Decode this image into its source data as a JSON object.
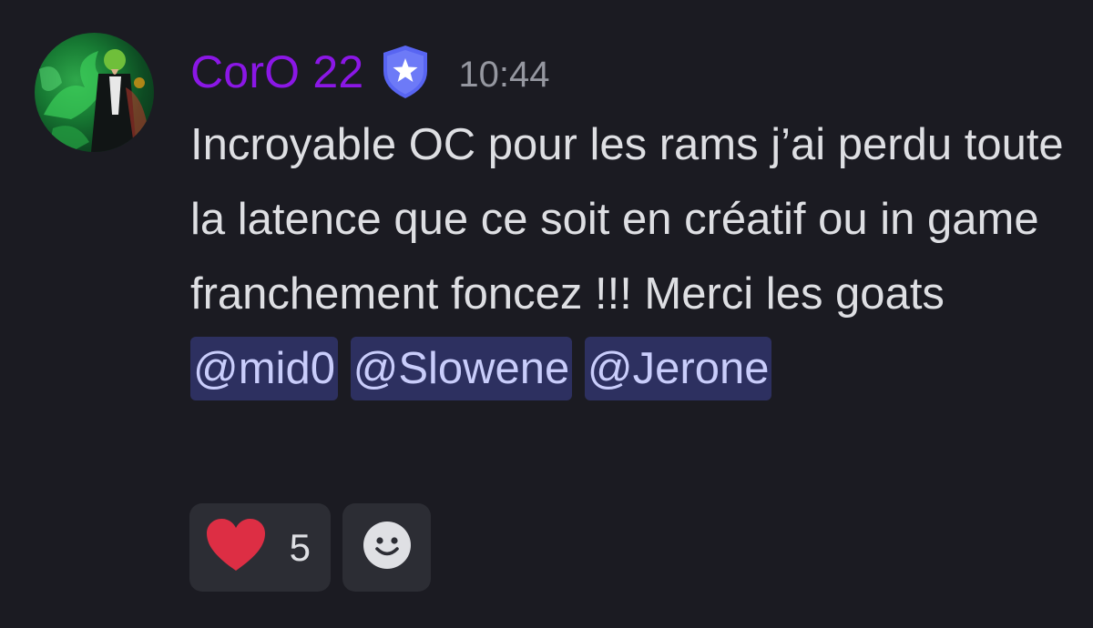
{
  "message": {
    "author": {
      "name": "CorO 22",
      "name_color": "#8b17e6",
      "badge_icon": "shield-star-icon",
      "avatar_icon": "green-dragon-avatar"
    },
    "timestamp": "10:44",
    "text_parts": [
      "Incroyable OC pour les rams j’ai perdu toute la latence que ce soit en créatif ou in game franchement foncez !!! Merci les goats",
      " ",
      " ",
      ""
    ],
    "mentions": [
      "@mid0",
      "@Slowene",
      "@Jerone"
    ],
    "mention_color": "#5865f2"
  },
  "reactions": [
    {
      "emoji": "heart-icon",
      "count": "5",
      "color": "#dd2e44"
    },
    {
      "emoji": "add-reaction-smiley-icon"
    }
  ],
  "colors": {
    "background": "#1b1b22",
    "text": "#dedfe3",
    "timestamp": "#9597a0",
    "reaction_bg": "#2c2d34"
  }
}
